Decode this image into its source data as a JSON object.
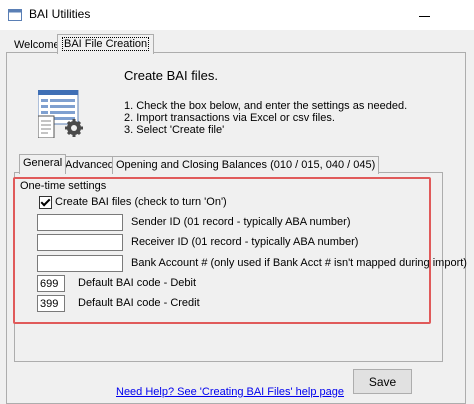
{
  "window": {
    "title": "BAI Utilities"
  },
  "outer_tabs": [
    {
      "label": "Welcome"
    },
    {
      "label": "BAI File Creation"
    }
  ],
  "main": {
    "heading": "Create BAI files.",
    "steps": [
      "1. Check the box below, and enter the settings as needed.",
      "2. Import transactions via Excel or csv files.",
      "3. Select 'Create file'"
    ],
    "icon": "document-table-gear-icon"
  },
  "inner_tabs": [
    {
      "label": "General"
    },
    {
      "label": "Advanced"
    },
    {
      "label": "Opening and Closing Balances (010 / 015, 040 / 045)"
    }
  ],
  "settings": {
    "group_label": "One-time settings",
    "create_bai_checked": true,
    "create_bai_label": "Create BAI files (check to turn 'On')",
    "sender_id": {
      "label": "Sender ID (01 record - typically ABA number)",
      "value": ""
    },
    "receiver_id": {
      "label": "Receiver ID (01 record - typically ABA number)",
      "value": ""
    },
    "bank_account": {
      "label": "Bank Account # (only used if Bank Acct # isn't mapped during import)",
      "value": ""
    },
    "debit_code": {
      "label": "Default BAI code - Debit",
      "value": "699"
    },
    "credit_code": {
      "label": "Default BAI code - Credit",
      "value": "399"
    }
  },
  "footer": {
    "help_link": "Need Help? See 'Creating BAI Files' help page",
    "save_label": "Save"
  },
  "colors": {
    "highlight": "#e05a5a",
    "link": "#0000ee"
  }
}
